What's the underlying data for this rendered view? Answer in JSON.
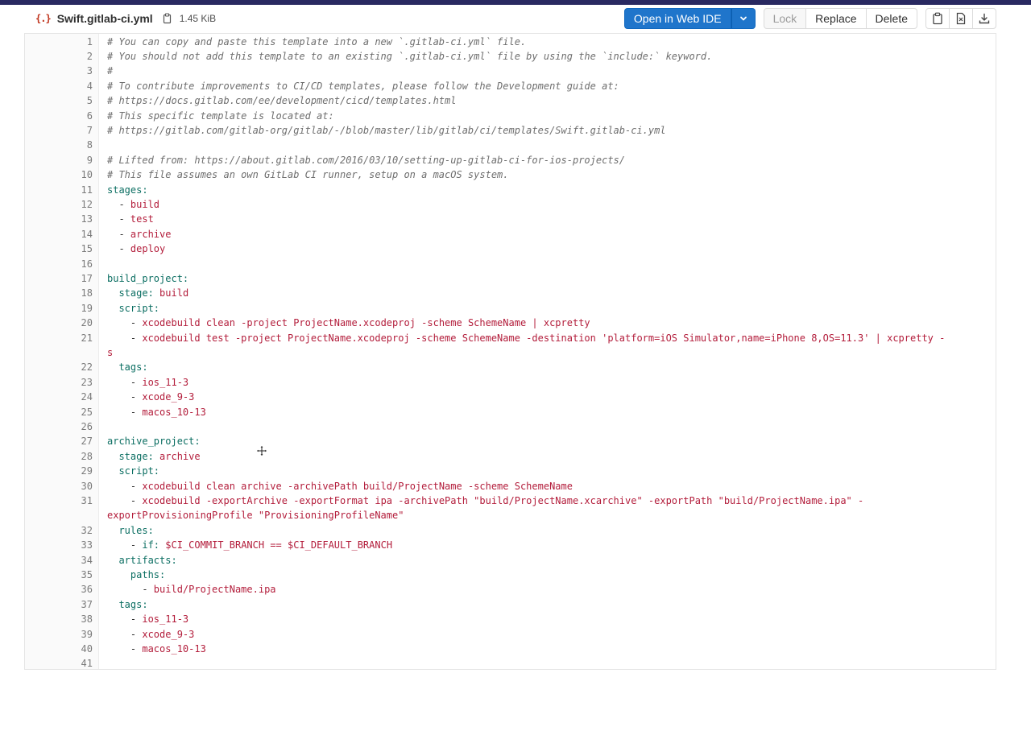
{
  "file": {
    "icon": "yaml-file-icon",
    "name": "Swift.gitlab-ci.yml",
    "size": "1.45 KiB"
  },
  "toolbar": {
    "open_web_ide": "Open in Web IDE",
    "lock": "Lock",
    "replace": "Replace",
    "delete": "Delete",
    "icons": [
      "copy-contents-icon",
      "open-raw-icon",
      "download-icon"
    ]
  },
  "colors": {
    "primary": "#1f75cb",
    "comment": "#6e6e6e",
    "key": "#0b6e62",
    "value": "#b31d3b"
  },
  "code_lines": [
    {
      "n": "1",
      "t": "comment",
      "parts": [
        {
          "c": "# You can copy and paste this template into a new `.gitlab-ci.yml` file."
        }
      ]
    },
    {
      "n": "2",
      "t": "comment",
      "parts": [
        {
          "c": "# You should not add this template to an existing `.gitlab-ci.yml` file by using the `include:` keyword."
        }
      ]
    },
    {
      "n": "3",
      "t": "comment",
      "parts": [
        {
          "c": "#"
        }
      ]
    },
    {
      "n": "4",
      "t": "comment",
      "parts": [
        {
          "c": "# To contribute improvements to CI/CD templates, please follow the Development guide at:"
        }
      ]
    },
    {
      "n": "5",
      "t": "comment",
      "parts": [
        {
          "c": "# https://docs.gitlab.com/ee/development/cicd/templates.html"
        }
      ]
    },
    {
      "n": "6",
      "t": "comment",
      "parts": [
        {
          "c": "# This specific template is located at:"
        }
      ]
    },
    {
      "n": "7",
      "t": "comment",
      "parts": [
        {
          "c": "# https://gitlab.com/gitlab-org/gitlab/-/blob/master/lib/gitlab/ci/templates/Swift.gitlab-ci.yml"
        }
      ]
    },
    {
      "n": "8",
      "t": "code",
      "parts": []
    },
    {
      "n": "9",
      "t": "comment",
      "parts": [
        {
          "c": "# Lifted from: https://about.gitlab.com/2016/03/10/setting-up-gitlab-ci-for-ios-projects/"
        }
      ]
    },
    {
      "n": "10",
      "t": "comment",
      "parts": [
        {
          "c": "# This file assumes an own GitLab CI runner, setup on a macOS system."
        }
      ]
    },
    {
      "n": "11",
      "t": "code",
      "parts": [
        {
          "k": "stages:"
        }
      ]
    },
    {
      "n": "12",
      "t": "code",
      "parts": [
        {
          "p": "  - "
        },
        {
          "v": "build"
        }
      ]
    },
    {
      "n": "13",
      "t": "code",
      "parts": [
        {
          "p": "  - "
        },
        {
          "v": "test"
        }
      ]
    },
    {
      "n": "14",
      "t": "code",
      "parts": [
        {
          "p": "  - "
        },
        {
          "v": "archive"
        }
      ]
    },
    {
      "n": "15",
      "t": "code",
      "parts": [
        {
          "p": "  - "
        },
        {
          "v": "deploy"
        }
      ]
    },
    {
      "n": "16",
      "t": "code",
      "parts": []
    },
    {
      "n": "17",
      "t": "code",
      "parts": [
        {
          "k": "build_project:"
        }
      ]
    },
    {
      "n": "18",
      "t": "code",
      "parts": [
        {
          "p": "  "
        },
        {
          "k": "stage:"
        },
        {
          "p": " "
        },
        {
          "v": "build"
        }
      ]
    },
    {
      "n": "19",
      "t": "code",
      "parts": [
        {
          "p": "  "
        },
        {
          "k": "script:"
        }
      ]
    },
    {
      "n": "20",
      "t": "code",
      "parts": [
        {
          "p": "    - "
        },
        {
          "v": "xcodebuild clean -project ProjectName.xcodeproj -scheme SchemeName | xcpretty"
        }
      ]
    },
    {
      "n": "21",
      "t": "code",
      "parts": [
        {
          "p": "    - "
        },
        {
          "v": "xcodebuild test -project ProjectName.xcodeproj -scheme SchemeName -destination 'platform=iOS Simulator,name=iPhone 8,OS=11.3' | xcpretty -"
        }
      ]
    },
    {
      "n": "",
      "t": "code",
      "parts": [
        {
          "v": "s"
        }
      ]
    },
    {
      "n": "22",
      "t": "code",
      "parts": [
        {
          "p": "  "
        },
        {
          "k": "tags:"
        }
      ]
    },
    {
      "n": "23",
      "t": "code",
      "parts": [
        {
          "p": "    - "
        },
        {
          "v": "ios_11-3"
        }
      ]
    },
    {
      "n": "24",
      "t": "code",
      "parts": [
        {
          "p": "    - "
        },
        {
          "v": "xcode_9-3"
        }
      ]
    },
    {
      "n": "25",
      "t": "code",
      "parts": [
        {
          "p": "    - "
        },
        {
          "v": "macos_10-13"
        }
      ]
    },
    {
      "n": "26",
      "t": "code",
      "parts": []
    },
    {
      "n": "27",
      "t": "code",
      "parts": [
        {
          "k": "archive_project:"
        }
      ]
    },
    {
      "n": "28",
      "t": "code",
      "parts": [
        {
          "p": "  "
        },
        {
          "k": "stage:"
        },
        {
          "p": " "
        },
        {
          "v": "archive"
        }
      ]
    },
    {
      "n": "29",
      "t": "code",
      "parts": [
        {
          "p": "  "
        },
        {
          "k": "script:"
        }
      ]
    },
    {
      "n": "30",
      "t": "code",
      "parts": [
        {
          "p": "    - "
        },
        {
          "v": "xcodebuild clean archive -archivePath build/ProjectName -scheme SchemeName"
        }
      ]
    },
    {
      "n": "31",
      "t": "code",
      "parts": [
        {
          "p": "    - "
        },
        {
          "v": "xcodebuild -exportArchive -exportFormat ipa -archivePath \"build/ProjectName.xcarchive\" -exportPath \"build/ProjectName.ipa\" -"
        }
      ]
    },
    {
      "n": "",
      "t": "code",
      "parts": [
        {
          "v": "exportProvisioningProfile \"ProvisioningProfileName\""
        }
      ]
    },
    {
      "n": "32",
      "t": "code",
      "parts": [
        {
          "p": "  "
        },
        {
          "k": "rules:"
        }
      ]
    },
    {
      "n": "33",
      "t": "code",
      "parts": [
        {
          "p": "    - "
        },
        {
          "k": "if:"
        },
        {
          "p": " "
        },
        {
          "v": "$CI_COMMIT_BRANCH == $CI_DEFAULT_BRANCH"
        }
      ]
    },
    {
      "n": "34",
      "t": "code",
      "parts": [
        {
          "p": "  "
        },
        {
          "k": "artifacts:"
        }
      ]
    },
    {
      "n": "35",
      "t": "code",
      "parts": [
        {
          "p": "    "
        },
        {
          "k": "paths:"
        }
      ]
    },
    {
      "n": "36",
      "t": "code",
      "parts": [
        {
          "p": "      - "
        },
        {
          "v": "build/ProjectName.ipa"
        }
      ]
    },
    {
      "n": "37",
      "t": "code",
      "parts": [
        {
          "p": "  "
        },
        {
          "k": "tags:"
        }
      ]
    },
    {
      "n": "38",
      "t": "code",
      "parts": [
        {
          "p": "    - "
        },
        {
          "v": "ios_11-3"
        }
      ]
    },
    {
      "n": "39",
      "t": "code",
      "parts": [
        {
          "p": "    - "
        },
        {
          "v": "xcode_9-3"
        }
      ]
    },
    {
      "n": "40",
      "t": "code",
      "parts": [
        {
          "p": "    - "
        },
        {
          "v": "macos_10-13"
        }
      ]
    },
    {
      "n": "41",
      "t": "code",
      "parts": []
    }
  ]
}
